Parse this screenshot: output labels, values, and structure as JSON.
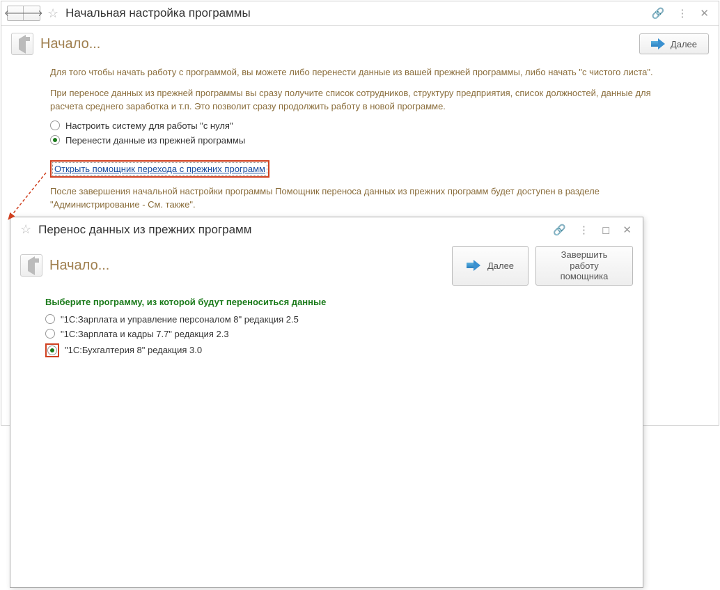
{
  "main": {
    "title": "Начальная настройка программы",
    "step_label": "Начало...",
    "next_label": "Далее",
    "para1": "Для того чтобы начать работу с программой, вы можете либо перенести данные из вашей прежней программы, либо начать \"с чистого листа\".",
    "para2": "При переносе данных из прежней программы вы сразу получите список сотрудников, структуру предприятия, список должностей, данные для расчета среднего заработка и т.п. Это позволит сразу продолжить работу в новой программе.",
    "radio1": "Настроить систему для работы \"с нуля\"",
    "radio2": "Перенести данные из прежней программы",
    "link": "Открыть помощник перехода с прежних программ",
    "footnote": "После завершения начальной настройки программы Помощник переноса данных из прежних программ будет доступен в разделе \"Администрирование - См. также\"."
  },
  "sub": {
    "title": "Перенос данных из прежних программ",
    "step_label": "Начало...",
    "next_label": "Далее",
    "finish_label": "Завершить работу помощника",
    "prompt": "Выберите программу, из которой будут переноситься данные",
    "opt1": "\"1С:Зарплата и управление персоналом 8\" редакция 2.5",
    "opt2": "\"1С:Зарплата и кадры 7.7\" редакция 2.3",
    "opt3": "\"1С:Бухгалтерия 8\" редакция 3.0"
  }
}
